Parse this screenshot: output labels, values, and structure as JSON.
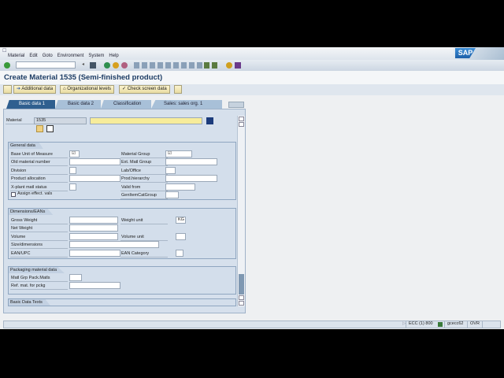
{
  "menu": [
    "Material",
    "Edit",
    "Goto",
    "Environment",
    "System",
    "Help"
  ],
  "title": "Create Material 1535 (Semi-finished product)",
  "app_toolbar": {
    "additional": "Additional data",
    "org": "Organizational levels",
    "check": "Check screen data"
  },
  "tabs": [
    "Basic data 1",
    "Basic data 2",
    "Classification",
    "Sales: sales org. 1"
  ],
  "header": {
    "material_label": "Material",
    "material_value": "1535"
  },
  "general": {
    "title": "General data",
    "rows": [
      {
        "l": "Base Unit of Measure",
        "v": "☑",
        "l2": "Material Group",
        "v2": "☑"
      },
      {
        "l": "Old material number",
        "v": "",
        "l2": "Ext. Matl Group",
        "v2": ""
      },
      {
        "l": "Division",
        "v": "",
        "l2": "Lab/Office",
        "v2": ""
      },
      {
        "l": "Product allocation",
        "v": "",
        "l2": "Prod.hierarchy",
        "v2": ""
      },
      {
        "l": "X-plant matl status",
        "v": "",
        "l2": "Valid from",
        "v2": ""
      }
    ],
    "assign": "Assign effect. vals",
    "genitem": "GenItemCatGroup"
  },
  "dimensions": {
    "title": "Dimensions/EANs",
    "gross": "Gross Weight",
    "weight_unit": "Weight unit",
    "weight_unit_value": "KG",
    "net": "Net Weight",
    "volume": "Volume",
    "volume_unit": "Volume unit",
    "size": "Size/dimensions",
    "ean": "EAN/UPC",
    "ean_cat": "EAN Category"
  },
  "packaging": {
    "title": "Packaging material data",
    "grp": "Matl Grp Pack.Matls",
    "ref": "Ref. mat. for pckg"
  },
  "basic_texts": {
    "title": "Basic Data Texts"
  },
  "status": {
    "system": "ECC (1) 800",
    "server": "gcecc62",
    "mode": "OVR"
  },
  "brand": "SAP"
}
